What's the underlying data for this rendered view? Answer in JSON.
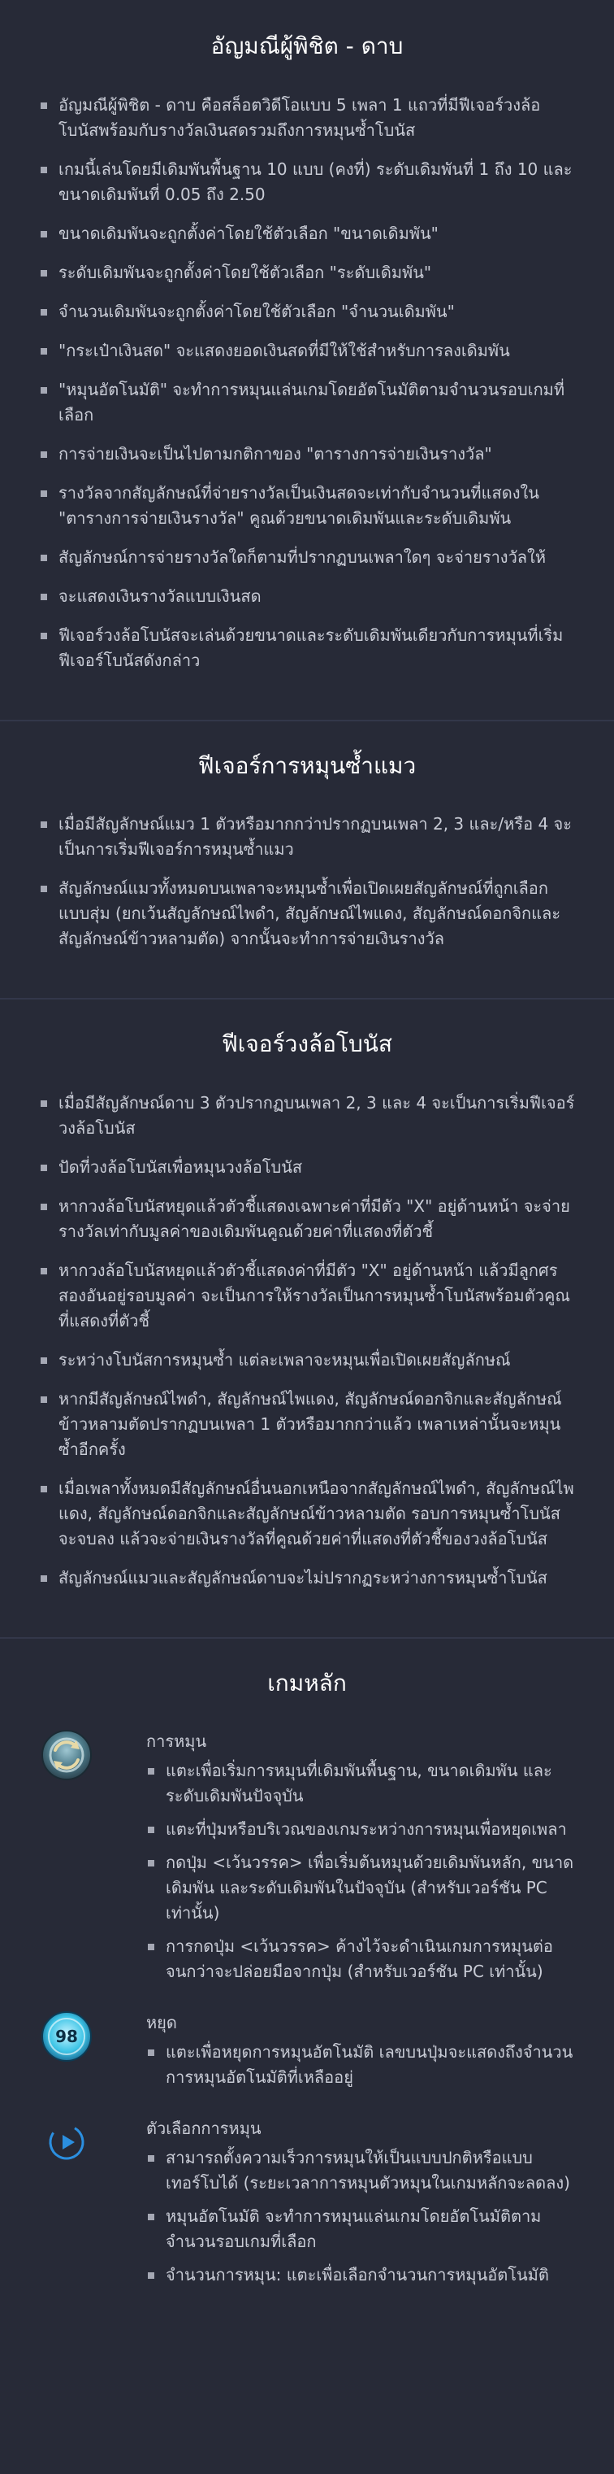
{
  "sections": [
    {
      "title": "อัญมณีผู้พิชิต - ดาบ",
      "items": [
        "อัญมณีผู้พิชิต - ดาบ คือสล็อตวิดีโอแบบ 5 เพลา 1 แถวที่มีฟีเจอร์วงล้อโบนัสพร้อมกับรางวัลเงินสดรวมถึงการหมุนซ้ำโบนัส",
        "เกมนี้เล่นโดยมีเดิมพันพื้นฐาน 10 แบบ (คงที่) ระดับเดิมพันที่ 1 ถึง 10 และขนาดเดิมพันที่ 0.05 ถึง 2.50",
        "ขนาดเดิมพันจะถูกตั้งค่าโดยใช้ตัวเลือก \"ขนาดเดิมพัน\"",
        "ระดับเดิมพันจะถูกตั้งค่าโดยใช้ตัวเลือก \"ระดับเดิมพัน\"",
        "จำนวนเดิมพันจะถูกตั้งค่าโดยใช้ตัวเลือก \"จำนวนเดิมพัน\"",
        "\"กระเป๋าเงินสด\" จะแสดงยอดเงินสดที่มีให้ใช้สำหรับการลงเดิมพัน",
        "\"หมุนอัตโนมัติ\" จะทำการหมุนแล่นเกมโดยอัตโนมัติตามจำนวนรอบเกมที่เลือก",
        "การจ่ายเงินจะเป็นไปตามกติกาของ \"ตารางการจ่ายเงินรางวัล\"",
        "รางวัลจากสัญลักษณ์ที่จ่ายรางวัลเป็นเงินสดจะเท่ากับจำนวนที่แสดงใน \"ตารางการจ่ายเงินรางวัล\" คูณด้วยขนาดเดิมพันและระดับเดิมพัน",
        "สัญลักษณ์การจ่ายรางวัลใดก็ตามที่ปรากฏบนเพลาใดๆ จะจ่ายรางวัลให้",
        "จะแสดงเงินรางวัลแบบเงินสด",
        "ฟีเจอร์วงล้อโบนัสจะเล่นด้วยขนาดและระดับเดิมพันเดียวกับการหมุนที่เริ่มฟีเจอร์โบนัสดังกล่าว"
      ]
    },
    {
      "title": "ฟีเจอร์การหมุนซ้ำแมว",
      "items": [
        "เมื่อมีสัญลักษณ์แมว 1 ตัวหรือมากกว่าปรากฏบนเพลา 2, 3 และ/หรือ 4 จะเป็นการเริ่มฟีเจอร์การหมุนซ้ำแมว",
        "สัญลักษณ์แมวทั้งหมดบนเพลาจะหมุนซ้ำเพื่อเปิดเผยสัญลักษณ์ที่ถูกเลือกแบบสุ่ม (ยกเว้นสัญลักษณ์ไพดำ, สัญลักษณ์ไพแดง, สัญลักษณ์ดอกจิกและสัญลักษณ์ข้าวหลามตัด) จากนั้นจะทำการจ่ายเงินรางวัล"
      ]
    },
    {
      "title": "ฟีเจอร์วงล้อโบนัส",
      "items": [
        "เมื่อมีสัญลักษณ์ดาบ 3 ตัวปรากฏบนเพลา 2, 3 และ 4 จะเป็นการเริ่มฟีเจอร์วงล้อโบนัส",
        "ปัดที่วงล้อโบนัสเพื่อหมุนวงล้อโบนัส",
        "หากวงล้อโบนัสหยุดแล้วตัวชี้แสดงเฉพาะค่าที่มีตัว \"X\" อยู่ด้านหน้า จะจ่ายรางวัลเท่ากับมูลค่าของเดิมพันคูณด้วยค่าที่แสดงที่ตัวชี้",
        "หากวงล้อโบนัสหยุดแล้วตัวชี้แสดงค่าที่มีตัว \"X\" อยู่ด้านหน้า แล้วมีลูกศรสองอันอยู่รอบมูลค่า จะเป็นการให้รางวัลเป็นการหมุนซ้ำโบนัสพร้อมตัวคูณที่แสดงที่ตัวชี้",
        "ระหว่างโบนัสการหมุนซ้ำ แต่ละเพลาจะหมุนเพื่อเปิดเผยสัญลักษณ์",
        "หากมีสัญลักษณ์ไพดำ, สัญลักษณ์ไพแดง, สัญลักษณ์ดอกจิกและสัญลักษณ์ข้าวหลามตัดปรากฏบนเพลา 1 ตัวหรือมากกว่าแล้ว เพลาเหล่านั้นจะหมุนซ้ำอีกครั้ง",
        "เมื่อเพลาทั้งหมดมีสัญลักษณ์อื่นนอกเหนือจากสัญลักษณ์ไพดำ, สัญลักษณ์ไพแดง, สัญลักษณ์ดอกจิกและสัญลักษณ์ข้าวหลามตัด รอบการหมุนซ้ำโบนัสจะจบลง แล้วจะจ่ายเงินรางวัลที่คูณด้วยค่าที่แสดงที่ตัวชี้ของวงล้อโบนัส",
        "สัญลักษณ์แมวและสัญลักษณ์ดาบจะไม่ปรากฏระหว่างการหมุนซ้ำโบนัส"
      ]
    }
  ],
  "controls": {
    "title": "เกมหลัก",
    "items": [
      {
        "name": "การหมุน",
        "icon": "spin-button-icon",
        "points": [
          "แตะเพื่อเริ่มการหมุนที่เดิมพันพื้นฐาน, ขนาดเดิมพัน และระดับเดิมพันปัจจุบัน",
          "แตะที่ปุ่มหรือบริเวณของเกมระหว่างการหมุนเพื่อหยุดเพลา",
          "กดปุ่ม <เว้นวรรค> เพื่อเริ่มต้นหมุนด้วยเดิมพันหลัก, ขนาดเดิมพัน และระดับเดิมพันในปัจจุบัน (สำหรับเวอร์ชัน PC เท่านั้น)",
          "การกดปุ่ม <เว้นวรรค> ค้างไว้จะดำเนินเกมการหมุนต่อจนกว่าจะปล่อยมือจากปุ่ม (สำหรับเวอร์ชัน PC เท่านั้น)"
        ]
      },
      {
        "name": "หยุด",
        "icon": "autospin-stop-icon",
        "badge": "98",
        "points": [
          "แตะเพื่อหยุดการหมุนอัตโนมัติ เลขบนปุ่มจะแสดงถึงจำนวนการหมุนอัตโนมัติที่เหลืออยู่"
        ]
      },
      {
        "name": "ตัวเลือกการหมุน",
        "icon": "play-circle-icon",
        "points": [
          "สามารถตั้งความเร็วการหมุนให้เป็นแบบปกติหรือแบบเทอร์โบได้ (ระยะเวลาการหมุนตัวหมุนในเกมหลักจะลดลง)",
          "หมุนอัตโนมัติ จะทำการหมุนแล่นเกมโดยอัตโนมัติตามจำนวนรอบเกมที่เลือก",
          "จำนวนการหมุน: แตะเพื่อเลือกจำนวนการหมุนอัตโนมัติ"
        ]
      }
    ]
  },
  "colors": {
    "background": "#272a37",
    "text": "#c9ccd6",
    "heading": "#ffffff",
    "divider": "#33374a",
    "bullet": "#a5a8b4"
  }
}
